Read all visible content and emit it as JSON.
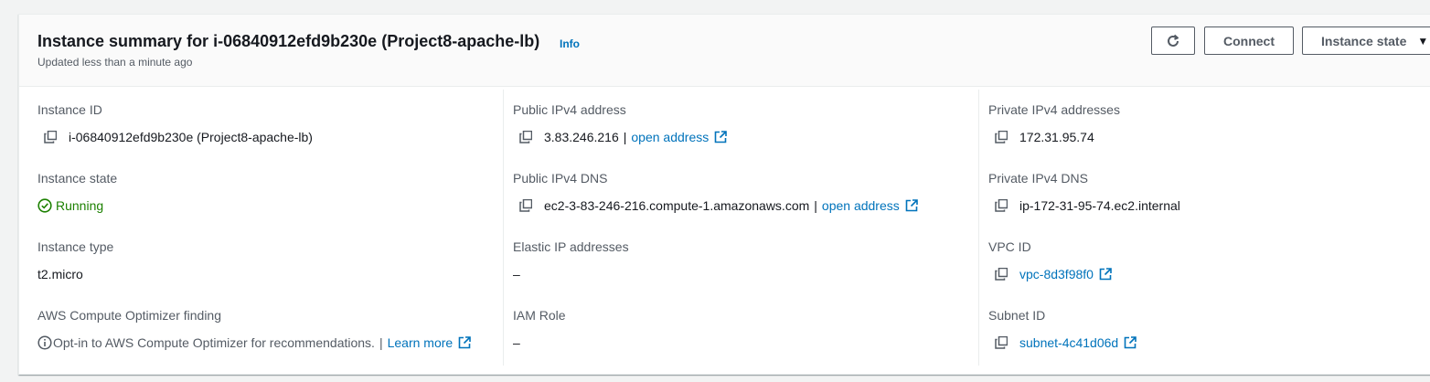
{
  "header": {
    "title": "Instance summary for i-06840912efd9b230e (Project8-apache-lb)",
    "info": "Info",
    "updated": "Updated less than a minute ago",
    "connect_label": "Connect",
    "instance_state_label": "Instance state"
  },
  "col1": {
    "instance_id": {
      "label": "Instance ID",
      "value": "i-06840912efd9b230e (Project8-apache-lb)"
    },
    "instance_state": {
      "label": "Instance state",
      "value": "Running"
    },
    "instance_type": {
      "label": "Instance type",
      "value": "t2.micro"
    },
    "optimizer": {
      "label": "AWS Compute Optimizer finding",
      "text": "Opt-in to AWS Compute Optimizer for recommendations.",
      "sep": "|",
      "link": "Learn more"
    }
  },
  "col2": {
    "public_ipv4": {
      "label": "Public IPv4 address",
      "value": "3.83.246.216",
      "sep": "|",
      "link": "open address"
    },
    "public_dns": {
      "label": "Public IPv4 DNS",
      "value": "ec2-3-83-246-216.compute-1.amazonaws.com",
      "sep": "|",
      "link": "open address"
    },
    "elastic_ip": {
      "label": "Elastic IP addresses",
      "value": "–"
    },
    "iam_role": {
      "label": "IAM Role",
      "value": "–"
    }
  },
  "col3": {
    "private_ipv4": {
      "label": "Private IPv4 addresses",
      "value": "172.31.95.74"
    },
    "private_dns": {
      "label": "Private IPv4 DNS",
      "value": "ip-172-31-95-74.ec2.internal"
    },
    "vpc_id": {
      "label": "VPC ID",
      "value": "vpc-8d3f98f0"
    },
    "subnet_id": {
      "label": "Subnet ID",
      "value": "subnet-4c41d06d"
    }
  },
  "colors": {
    "link": "#0073bb",
    "running": "#1d8102",
    "label": "#545b64",
    "text": "#16191f"
  }
}
